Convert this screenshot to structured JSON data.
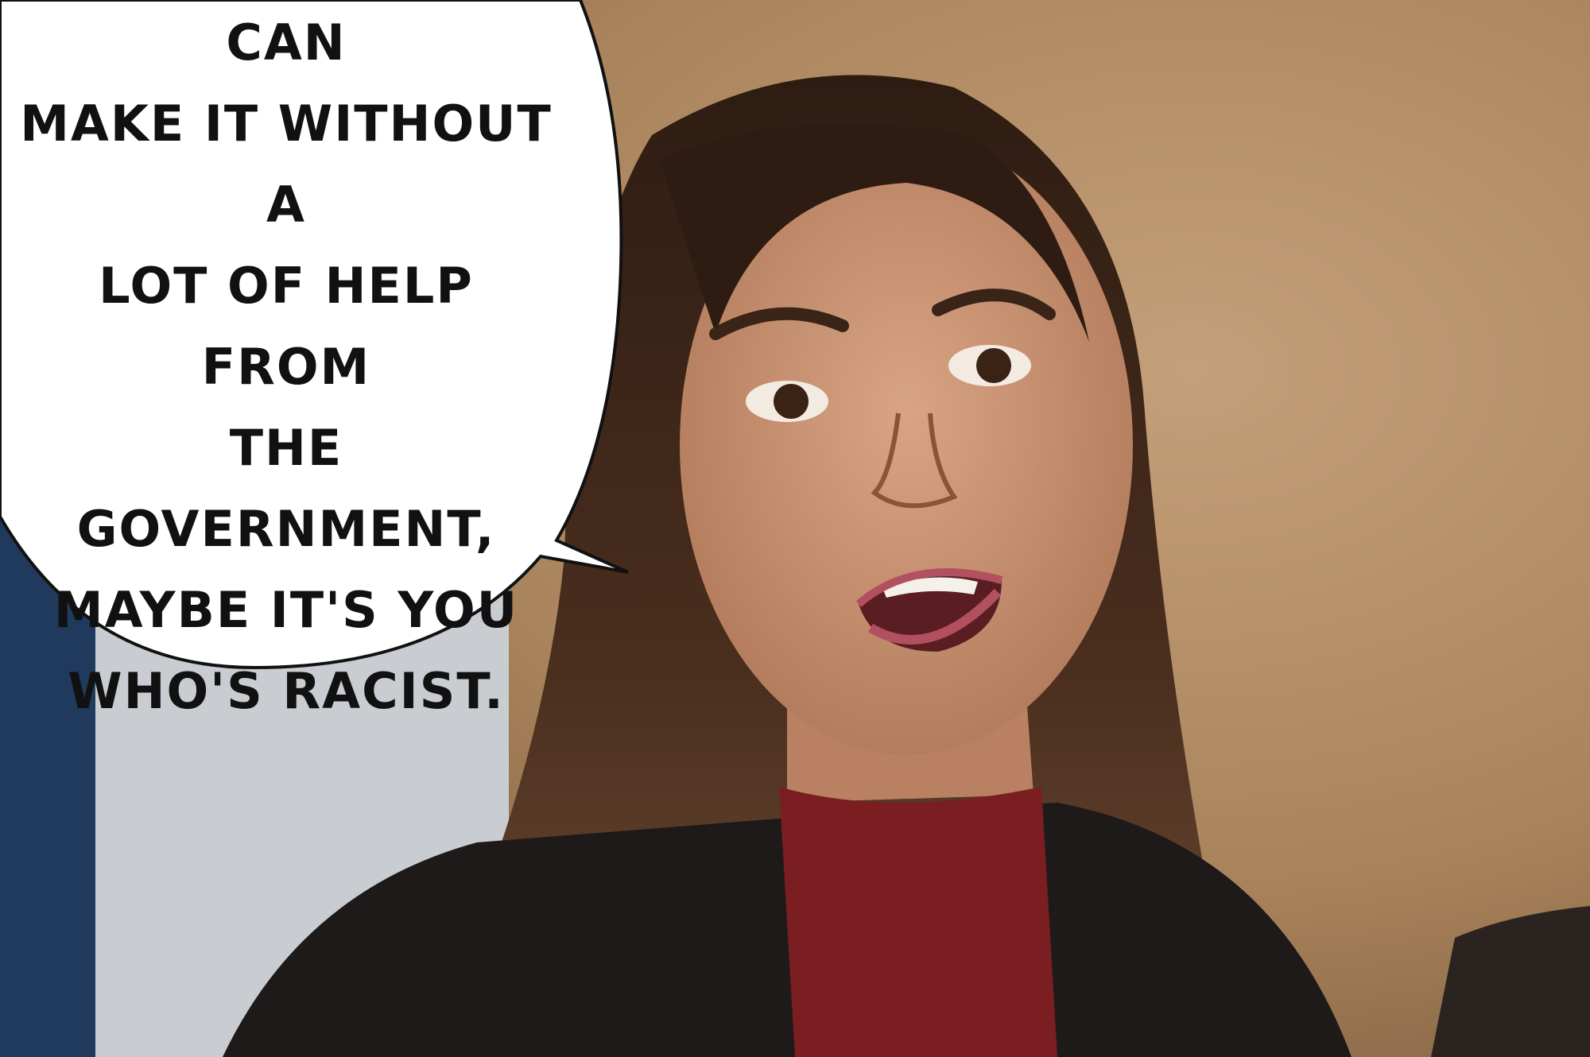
{
  "speech_bubble": {
    "text": "IF YOU BELIEVE\nBLACK PEOPLE CAN\nMAKE IT WITHOUT A\nLOT OF HELP FROM\nTHE GOVERNMENT,\nMAYBE IT'S YOU\nWHO'S RACIST."
  },
  "colors": {
    "background_wall": "#b08a62",
    "hair": "#3a2418",
    "skin": "#d09878",
    "sweater": "#7a1e22",
    "jacket": "#1e1a1a",
    "bubble_fill": "#ffffff",
    "bubble_outline": "#111111",
    "left_panel_blue": "#1f3a5c",
    "left_panel_gray": "#c9cdd2"
  }
}
